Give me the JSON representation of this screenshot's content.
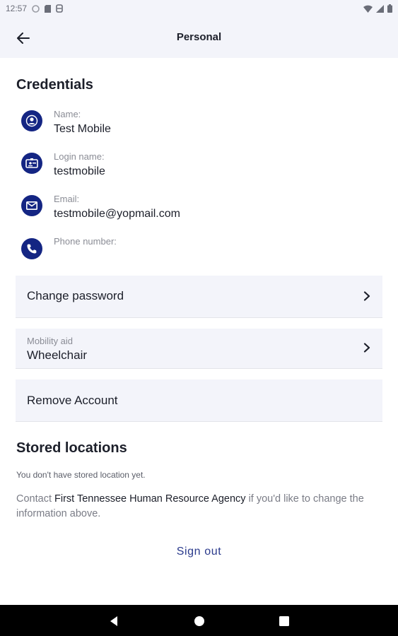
{
  "status_bar": {
    "time": "12:57"
  },
  "header": {
    "title": "Personal"
  },
  "credentials": {
    "title": "Credentials",
    "items": [
      {
        "label": "Name:",
        "value": "Test Mobile",
        "icon": "person-icon"
      },
      {
        "label": "Login name:",
        "value": "testmobile",
        "icon": "id-card-icon"
      },
      {
        "label": "Email:",
        "value": "testmobile@yopmail.com",
        "icon": "mail-icon"
      },
      {
        "label": "Phone number:",
        "value": "",
        "icon": "phone-icon"
      }
    ]
  },
  "actions": {
    "change_password": "Change password",
    "mobility_label": "Mobility aid",
    "mobility_value": "Wheelchair",
    "remove_account": "Remove Account"
  },
  "stored_locations": {
    "title": "Stored locations",
    "empty_text": "You don't have stored location yet."
  },
  "contact": {
    "prefix": "Contact ",
    "agency": "First Tennessee Human Resource Agency",
    "suffix": " if you'd like to change the information above."
  },
  "signout_label": "Sign out",
  "colors": {
    "accent": "#142583",
    "surface": "#f3f4fa",
    "link": "#2a3a8c"
  }
}
